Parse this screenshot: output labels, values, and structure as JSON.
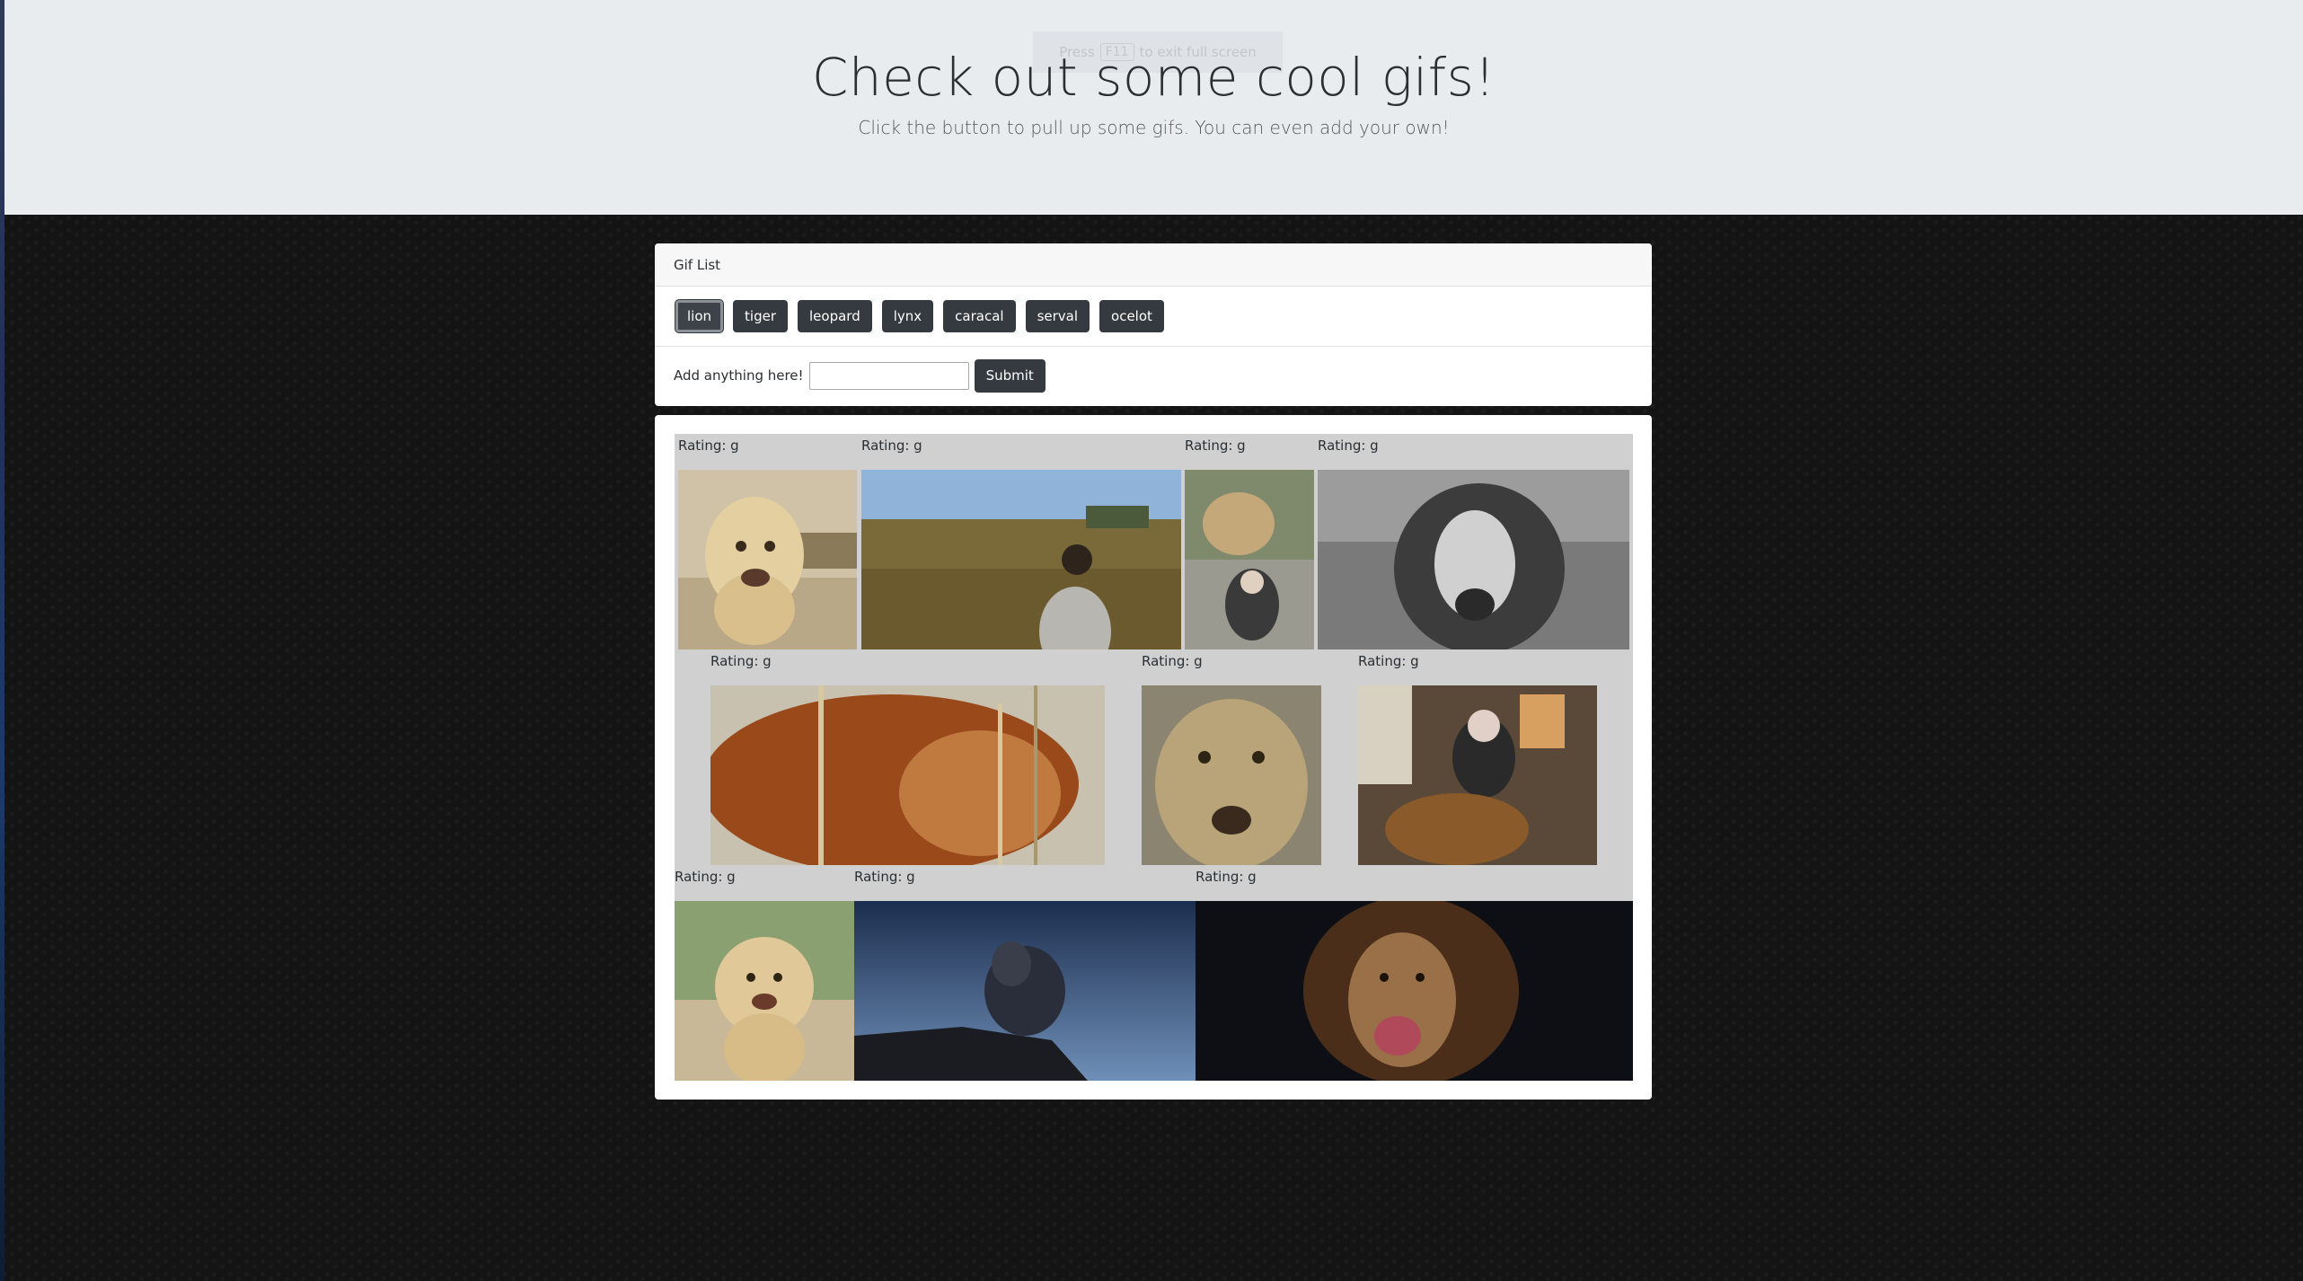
{
  "fullscreen_hint": {
    "prefix": "Press",
    "key": "F11",
    "suffix": "to exit full screen"
  },
  "jumbotron": {
    "title": "Check out some cool gifs!",
    "lead": "Click the button to pull up some gifs. You can even add your own!"
  },
  "gif_list": {
    "header": "Gif List",
    "buttons": [
      "lion",
      "tiger",
      "leopard",
      "lynx",
      "caracal",
      "serval",
      "ocelot"
    ],
    "active_button": "lion",
    "add_label": "Add anything here!",
    "add_input_value": "",
    "submit_label": "Submit"
  },
  "gifs": [
    {
      "rating": "Rating: g",
      "depicts": "lion cub walking toward camera"
    },
    {
      "rating": "Rating: g",
      "depicts": "man walking in savanna grass"
    },
    {
      "rating": "Rating: g",
      "depicts": "lioness behind glass with small child"
    },
    {
      "rating": "Rating: g",
      "depicts": "black and white lion roaring"
    },
    {
      "rating": "Rating: g",
      "depicts": "lion lying in tall grass"
    },
    {
      "rating": "Rating: g",
      "depicts": "lioness face close-up"
    },
    {
      "rating": "Rating: g",
      "depicts": "elderly woman sitting with a lion in living room"
    },
    {
      "rating": "Rating: g",
      "depicts": "lion cub standing on dirt"
    },
    {
      "rating": "Rating: g",
      "depicts": "animated lion roaring on pride rock at night"
    },
    {
      "rating": "Rating: g",
      "depicts": "lion roaring on dark background"
    }
  ],
  "colors": {
    "jumbotron_bg": "#e9ecef",
    "button_dark": "#343a40",
    "gif_area_bg": "#d0d0d0",
    "page_bg": "#141414"
  }
}
